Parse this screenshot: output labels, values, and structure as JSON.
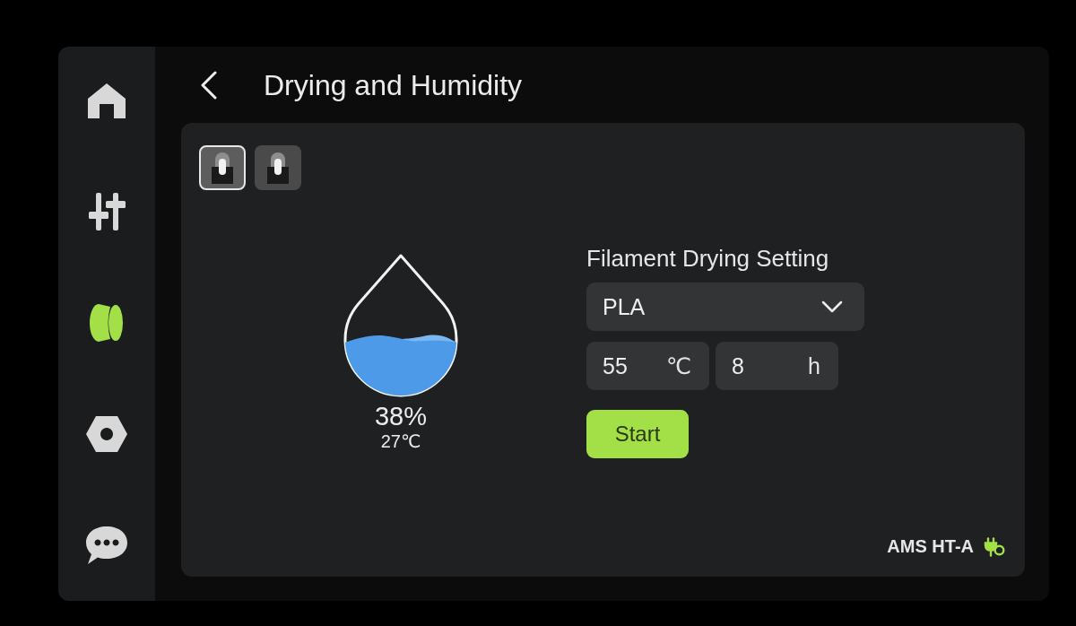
{
  "sidebar": {
    "items": [
      {
        "selected": false
      },
      {
        "selected": false
      },
      {
        "selected": true
      },
      {
        "selected": false
      },
      {
        "selected": false
      }
    ]
  },
  "header": {
    "title": "Drying and Humidity"
  },
  "units": [
    {
      "selected": true
    },
    {
      "selected": false
    }
  ],
  "humidity": {
    "level": 0.38,
    "reading": "38%",
    "temperature": "27℃"
  },
  "drying": {
    "title": "Filament Drying Setting",
    "material": "PLA",
    "temperature": {
      "value": "55",
      "unit": "℃"
    },
    "duration": {
      "value": "8",
      "unit": "h"
    },
    "start_button": "Start"
  },
  "device": {
    "name": "AMS HT-A"
  }
}
